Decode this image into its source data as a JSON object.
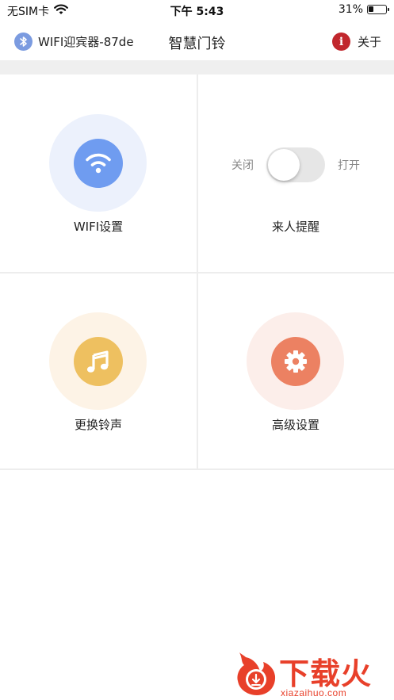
{
  "status_bar": {
    "carrier": "无SIM卡",
    "time": "下午 5:43",
    "battery": "31%",
    "battery_level": 0.31
  },
  "nav": {
    "device_name": "WIFI迎宾器-87de",
    "title": "智慧门铃",
    "about_label": "关于",
    "info_glyph": "i",
    "bluetooth_color": "#7b9be0",
    "info_color": "#c1272d"
  },
  "tiles": {
    "wifi": {
      "label": "WIFI设置",
      "icon": "wifi-icon",
      "color": "#6f9cf0"
    },
    "visitor": {
      "label": "来人提醒",
      "off_label": "关闭",
      "on_label": "打开",
      "toggle_on": false
    },
    "ringtone": {
      "label": "更换铃声",
      "icon": "music-note-icon",
      "color": "#eec060"
    },
    "advanced": {
      "label": "高级设置",
      "icon": "gear-icon",
      "color": "#ec8162"
    }
  },
  "watermark": {
    "text": "下载火",
    "url": "xiazaihuo.com",
    "color": "#e8402a"
  }
}
